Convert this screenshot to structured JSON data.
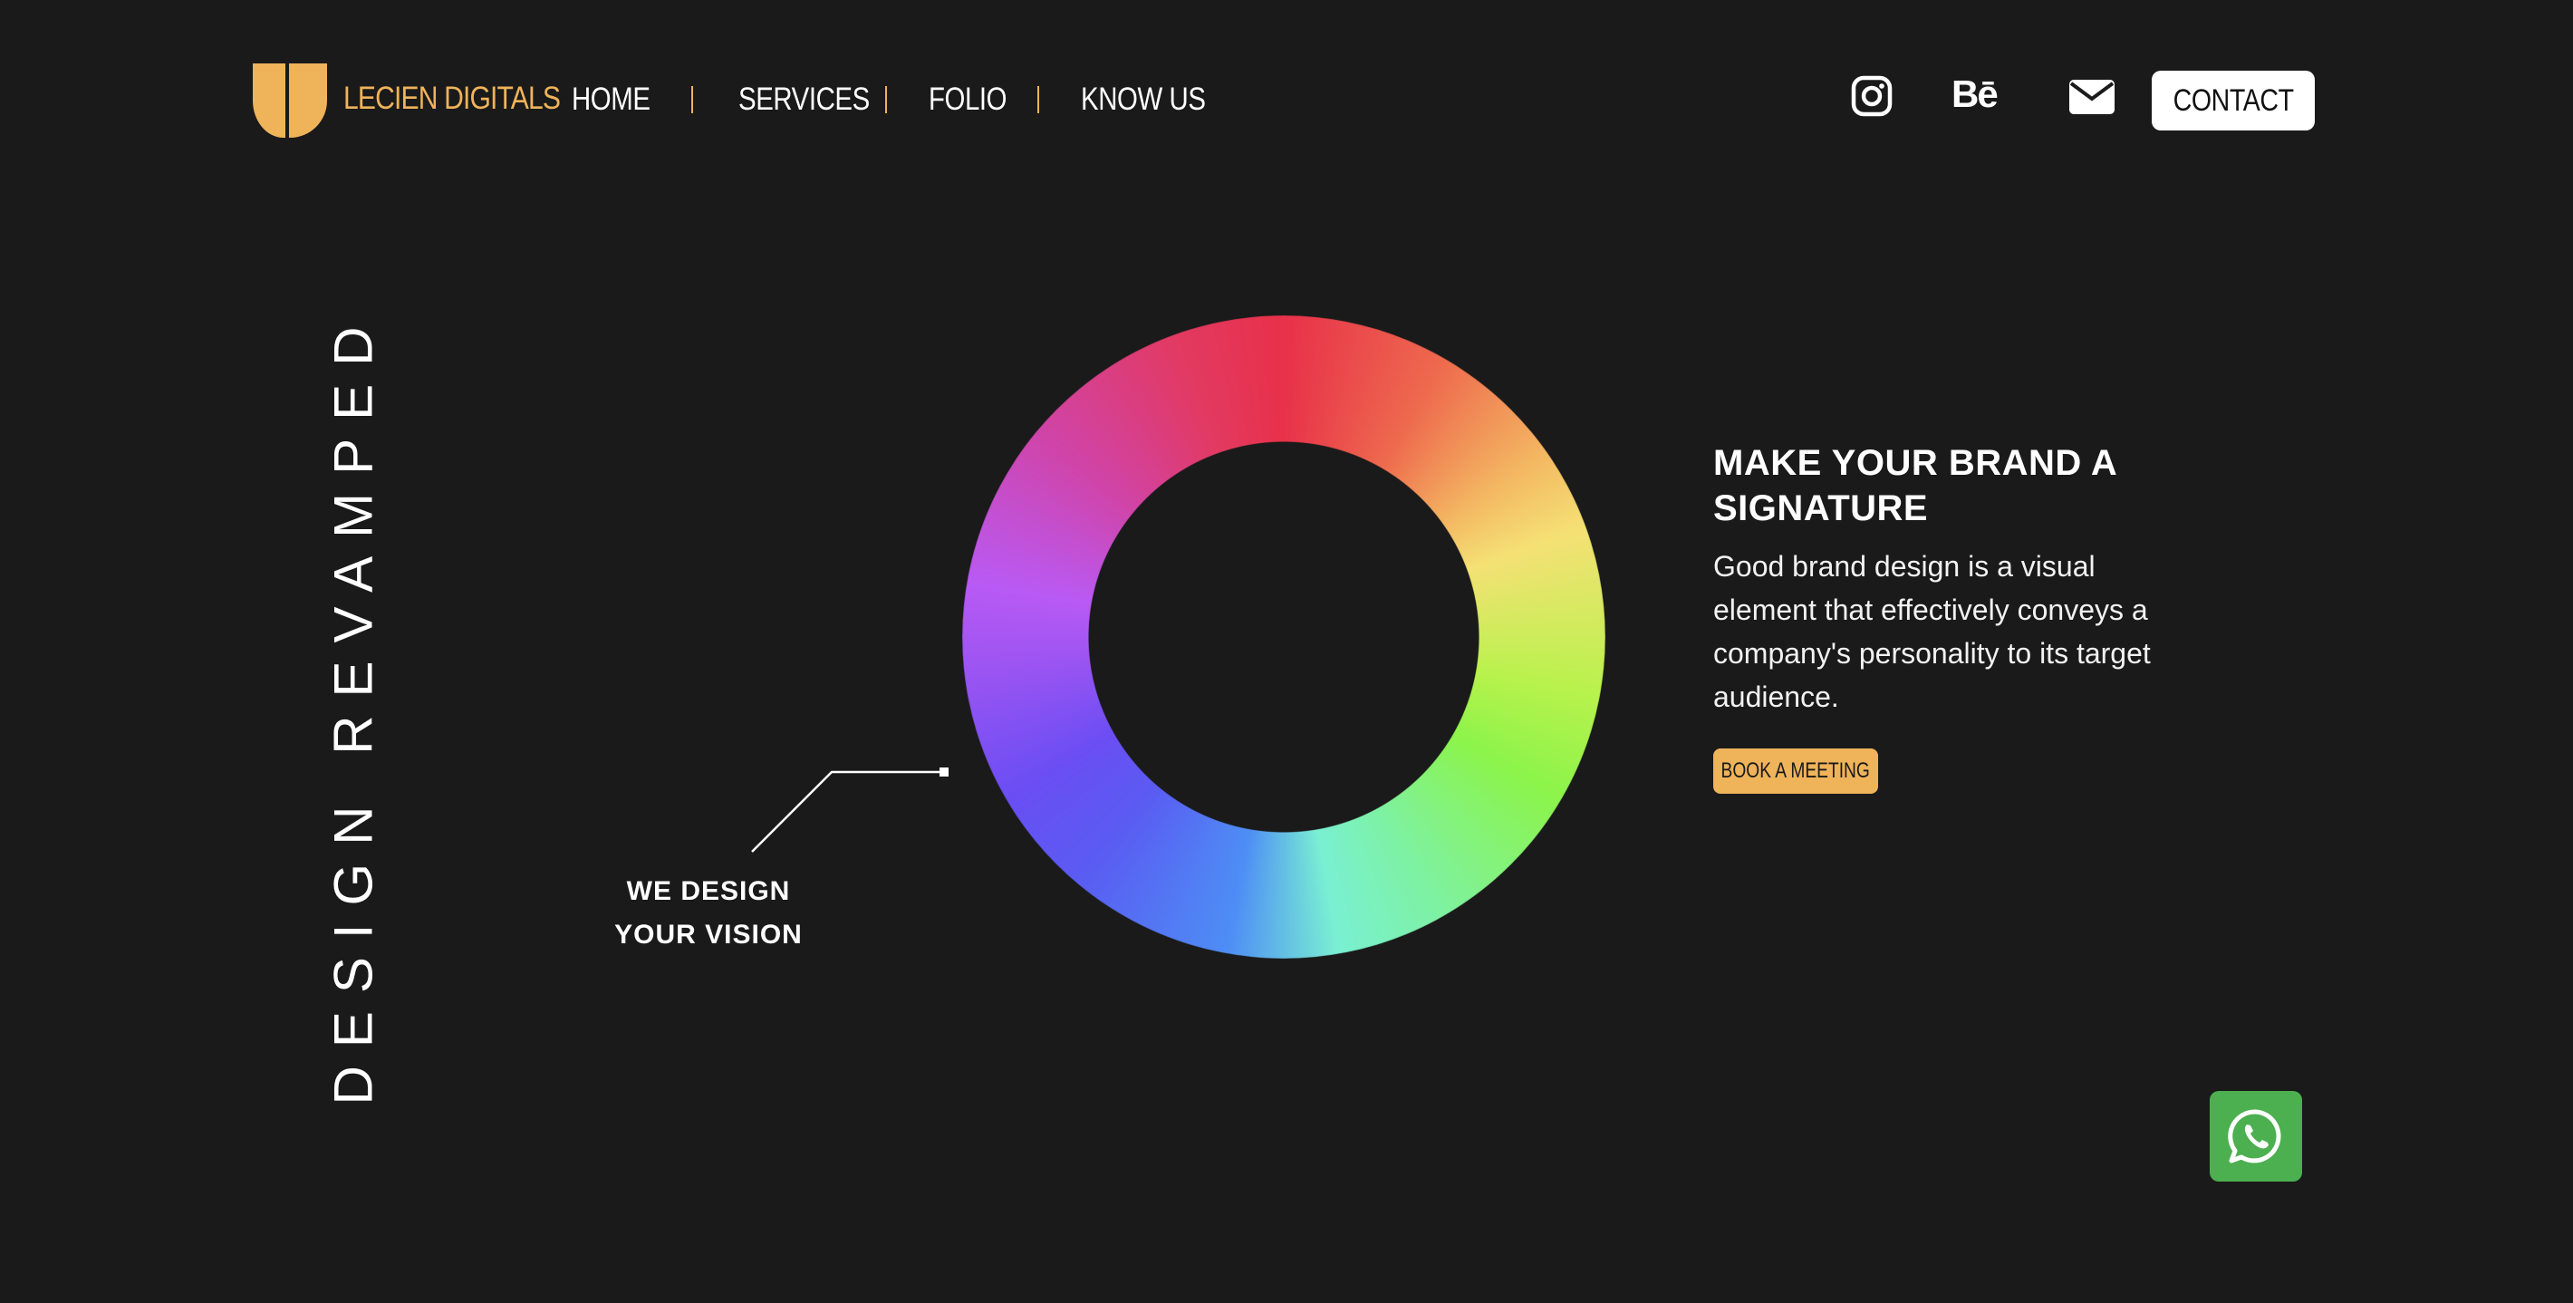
{
  "header": {
    "brand_name": "LECIEN DIGITALS",
    "nav": [
      {
        "label": "HOME"
      },
      {
        "label": "SERVICES"
      },
      {
        "label": "FOLIO"
      },
      {
        "label": "KNOW US"
      }
    ],
    "social": {
      "instagram_icon": "instagram-icon",
      "behance_label": "Bē",
      "mail_icon": "mail-icon"
    },
    "contact_label": "CONTACT"
  },
  "hero": {
    "vertical_heading": "DESIGN REVAMPED",
    "callout_line1": "WE DESIGN",
    "callout_line2": "YOUR VISION",
    "headline_line1": "MAKE YOUR BRAND A",
    "headline_line2": "SIGNATURE",
    "body_line1": "Good brand design is a visual",
    "body_line2": "element that effectively conveys a",
    "body_line3": "company's personality to its target",
    "body_line4": "audience.",
    "cta_label": "BOOK A MEETING"
  },
  "colors": {
    "background": "#1a1a1a",
    "accent": "#efb35a",
    "whatsapp": "#4caf50"
  },
  "floating": {
    "whatsapp_icon": "whatsapp-icon"
  }
}
